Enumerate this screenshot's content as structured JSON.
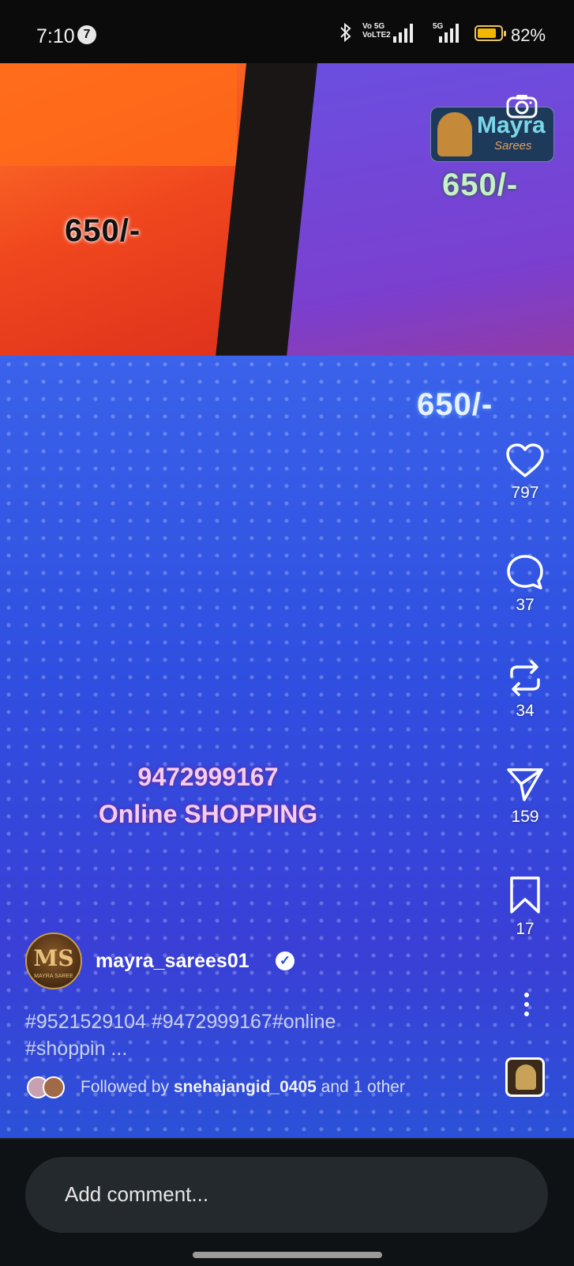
{
  "status_bar": {
    "time": "7:10",
    "notification_count": "7",
    "volte_label_1": "Vo 5G",
    "volte_label_2": "VoLTE2",
    "network_label": "5G",
    "battery_percent": "82%",
    "battery_level": 0.82,
    "battery_color": "#f2b705"
  },
  "video_overlay": {
    "brand_name": "Mayra",
    "brand_sub": "Sarees",
    "price_tags": [
      "650/-",
      "650/-",
      "650/-"
    ],
    "phone": "9472999167",
    "tagline": "Online SHOPPING"
  },
  "actions": {
    "likes": "797",
    "comments": "37",
    "reposts": "34",
    "shares": "159",
    "saves": "17"
  },
  "post": {
    "username": "mayra_sarees01",
    "verified": true,
    "avatar_text": "MS",
    "avatar_name": "MAYRA SAREE",
    "caption_line1": "#9521529104 #9472999167#online",
    "caption_line2": "#shoppin ...",
    "followed_prefix": "Followed by",
    "followed_user": "snehajangid_0405",
    "followed_suffix": "and 1 other"
  },
  "comment_box": {
    "placeholder": "Add comment..."
  },
  "icons": [
    "bluetooth-icon",
    "signal-icon",
    "battery-icon",
    "camera-icon",
    "heart-icon",
    "comment-icon",
    "repost-icon",
    "send-icon",
    "bookmark-icon",
    "more-icon",
    "verified-icon"
  ]
}
